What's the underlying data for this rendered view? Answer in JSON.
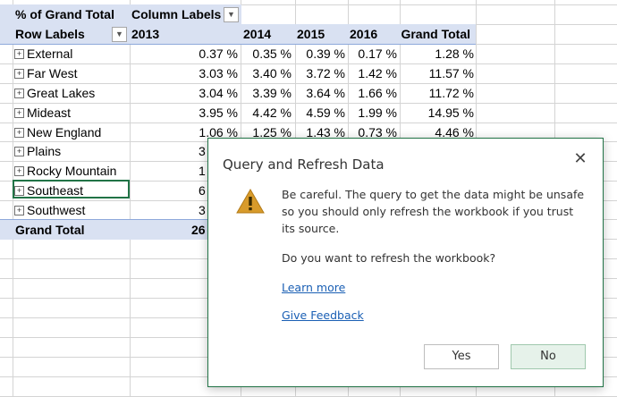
{
  "pivot": {
    "value_label": "% of Grand Total",
    "column_labels": "Column Labels",
    "row_labels": "Row Labels",
    "columns": [
      "2013",
      "2014",
      "2015",
      "2016",
      "Grand Total"
    ],
    "rows": [
      {
        "label": "External",
        "values": [
          "0.37 %",
          "0.35 %",
          "0.39 %",
          "0.17 %",
          "1.28 %"
        ]
      },
      {
        "label": "Far West",
        "values": [
          "3.03 %",
          "3.40 %",
          "3.72 %",
          "1.42 %",
          "11.57 %"
        ]
      },
      {
        "label": "Great Lakes",
        "values": [
          "3.04 %",
          "3.39 %",
          "3.64 %",
          "1.66 %",
          "11.72 %"
        ]
      },
      {
        "label": "Mideast",
        "values": [
          "3.95 %",
          "4.42 %",
          "4.59 %",
          "1.99 %",
          "14.95 %"
        ]
      },
      {
        "label": "New England",
        "values": [
          "1.06 %",
          "1.25 %",
          "1.43 %",
          "0.73 %",
          "4.46 %"
        ]
      },
      {
        "label": "Plains",
        "values": [
          "3",
          "",
          "",
          "",
          ""
        ]
      },
      {
        "label": "Rocky Mountain",
        "values": [
          "1",
          "",
          "",
          "",
          ""
        ]
      },
      {
        "label": "Southeast",
        "values": [
          "6",
          "",
          "",
          "",
          ""
        ]
      },
      {
        "label": "Southwest",
        "values": [
          "3",
          "",
          "",
          "",
          ""
        ]
      }
    ],
    "grand_total": {
      "label": "Grand Total",
      "values": [
        "26",
        "",
        "",
        "",
        ""
      ]
    },
    "expander_glyph": "+"
  },
  "dialog": {
    "title": "Query and Refresh Data",
    "close_glyph": "✕",
    "icon": "warning-icon",
    "message": "Be careful. The query to get the data might be unsafe so you should only refresh the workbook if you trust its source.",
    "question": "Do you want to refresh the workbook?",
    "learn_more": "Learn more",
    "give_feedback": "Give Feedback",
    "yes_label": "Yes",
    "no_label": "No"
  },
  "colors": {
    "pivot_header": "#d9e1f2",
    "selection": "#217346",
    "link": "#1a5fb4",
    "warning": "#d89b2b"
  }
}
